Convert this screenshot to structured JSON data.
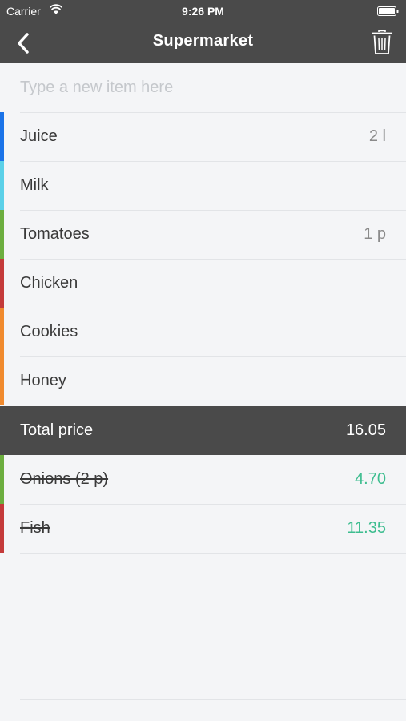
{
  "status_bar": {
    "carrier": "Carrier",
    "time": "9:26 PM"
  },
  "nav": {
    "title": "Supermarket",
    "back_icon": "chevron-left-icon",
    "trash_icon": "trash-icon"
  },
  "new_item": {
    "placeholder": "Type a new item here",
    "value": ""
  },
  "items": [
    {
      "name": "Juice",
      "quantity": "2 l",
      "color": "#1a73e8"
    },
    {
      "name": "Milk",
      "quantity": "",
      "color": "#5bd0e8"
    },
    {
      "name": "Tomatoes",
      "quantity": "1 p",
      "color": "#6cae3f"
    },
    {
      "name": "Chicken",
      "quantity": "",
      "color": "#c43a3a"
    },
    {
      "name": "Cookies",
      "quantity": "",
      "color": "#f08a2e"
    },
    {
      "name": "Honey",
      "quantity": "",
      "color": "#f08a2e"
    }
  ],
  "total": {
    "label": "Total price",
    "value": "16.05"
  },
  "purchased": [
    {
      "name": "Onions (2 p)",
      "price": "4.70",
      "color": "#6cae3f"
    },
    {
      "name": "Fish",
      "price": "11.35",
      "color": "#c43a3a"
    }
  ],
  "colors": {
    "header": "#4a4a4a",
    "background": "#f4f5f7",
    "price": "#3dbd8f"
  }
}
